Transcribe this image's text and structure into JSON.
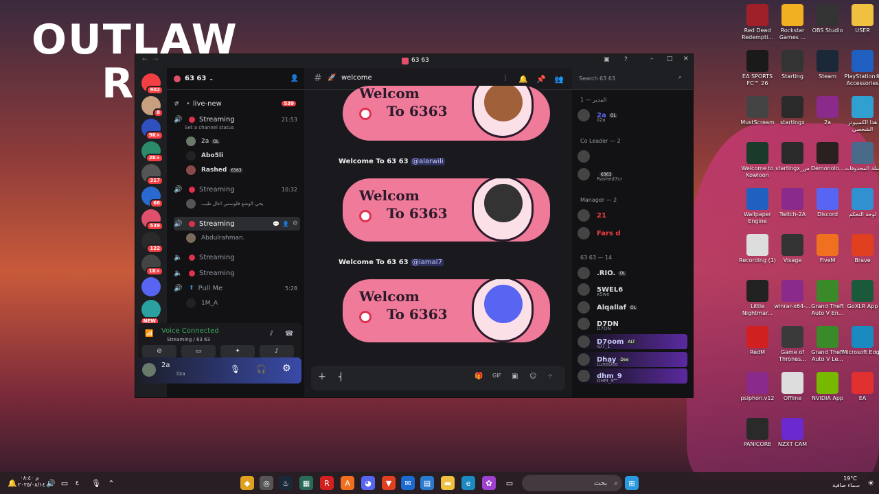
{
  "wallpaper": {
    "logo_line1": "OUTLAW",
    "logo_line2": "R"
  },
  "desktop_icons": [
    {
      "label": "Red Dead Redempti...",
      "icon": "rdr-icon",
      "color": "#a0202a"
    },
    {
      "label": "Rockstar Games ...",
      "icon": "rockstar-icon",
      "color": "#f0b020"
    },
    {
      "label": "OBS Studio",
      "icon": "obs-icon",
      "color": "#333333"
    },
    {
      "label": "USER",
      "icon": "folder-icon",
      "color": "#f0c040"
    },
    {
      "label": "EA SPORTS FC™ 26",
      "icon": "easports-icon",
      "color": "#1a1a1a"
    },
    {
      "label": "Starting",
      "icon": "starting-icon",
      "color": "#333333"
    },
    {
      "label": "Steam",
      "icon": "steam-icon",
      "color": "#1b2838"
    },
    {
      "label": "PlayStation® Accessories",
      "icon": "playstation-icon",
      "color": "#1f5fc0"
    },
    {
      "label": "MustScream",
      "icon": "mustscream-icon",
      "color": "#444444"
    },
    {
      "label": "startingx",
      "icon": "startingx-icon",
      "color": "#2a2a2a"
    },
    {
      "label": "2a",
      "icon": "winrar-icon",
      "color": "#8a2a8a"
    },
    {
      "label": "هذا الكمبيوتر الشخصي",
      "icon": "pc-icon",
      "color": "#30a0d0"
    },
    {
      "label": "Welcome to Kowloon",
      "icon": "kowloon-icon",
      "color": "#1a3a2a"
    },
    {
      "label": "startingx_س",
      "icon": "startingx2-icon",
      "color": "#2a2a2a"
    },
    {
      "label": "Demonolo...",
      "icon": "demonologist-icon",
      "color": "#2a2020"
    },
    {
      "label": "سلة المحذوفات",
      "icon": "recycle-bin-icon",
      "color": "#4a6a8a"
    },
    {
      "label": "Wallpaper Engine",
      "icon": "wallpaper-engine-icon",
      "color": "#2060c0"
    },
    {
      "label": "Twitch-2A",
      "icon": "winrar-icon",
      "color": "#8a2a8a"
    },
    {
      "label": "Discord",
      "icon": "discord-icon",
      "color": "#5865f2"
    },
    {
      "label": "لوحة التحكم",
      "icon": "control-panel-icon",
      "color": "#3090d0"
    },
    {
      "label": "Recording (1)",
      "icon": "recording-icon",
      "color": "#dddddd"
    },
    {
      "label": "Visage",
      "icon": "visage-icon",
      "color": "#333333"
    },
    {
      "label": "FiveM",
      "icon": "fivem-icon",
      "color": "#f07020"
    },
    {
      "label": "Brave",
      "icon": "brave-icon",
      "color": "#e04020"
    },
    {
      "label": "Little Nightmar...",
      "icon": "little-nightmares-icon",
      "color": "#222222"
    },
    {
      "label": "winrar-x64-...",
      "icon": "winrar-icon",
      "color": "#8a2a8a"
    },
    {
      "label": "Grand Theft Auto V En...",
      "icon": "gta-icon",
      "color": "#3a8a2a"
    },
    {
      "label": "GoXLR App",
      "icon": "goxlr-icon",
      "color": "#1a5a3a"
    },
    {
      "label": "RedM",
      "icon": "redm-icon",
      "color": "#d02020"
    },
    {
      "label": "Game of Thrones...",
      "icon": "got-icon",
      "color": "#3a3a3a"
    },
    {
      "label": "Grand Theft Auto V Le...",
      "icon": "gta-icon",
      "color": "#3a8a2a"
    },
    {
      "label": "Microsoft Edge",
      "icon": "edge-icon",
      "color": "#1a8ac0"
    },
    {
      "label": "psiphon.v12",
      "icon": "winrar-icon",
      "color": "#8a2a8a"
    },
    {
      "label": "Offline",
      "icon": "offline-icon",
      "color": "#dddddd"
    },
    {
      "label": "NVIDIA App",
      "icon": "nvidia-icon",
      "color": "#76b900"
    },
    {
      "label": "EA",
      "icon": "ea-icon",
      "color": "#e03030"
    },
    {
      "label": "PANICORE",
      "icon": "panicore-icon",
      "color": "#2a2a2a"
    },
    {
      "label": "NZXT CAM",
      "icon": "nzxt-icon",
      "color": "#6a2ad0"
    }
  ],
  "window": {
    "title": "63 63"
  },
  "servers": [
    {
      "badge": "902",
      "color": "#f23f43"
    },
    {
      "badge": "8",
      "color": "#c8a080"
    },
    {
      "badge": "9K+",
      "color": "#3050c0"
    },
    {
      "badge": "2K+",
      "color": "#2a8a6a"
    },
    {
      "badge": "317",
      "color": "#555555"
    },
    {
      "badge": "66",
      "color": "#2a6ad0"
    },
    {
      "badge": "539",
      "color": "#e0506a"
    },
    {
      "badge": "122",
      "color": "#2a2a2a"
    },
    {
      "badge": "1K+",
      "color": "#444444"
    },
    {
      "badge": "",
      "color": "#5865f2"
    },
    {
      "badge": "NEW",
      "color": "#2aa0a0"
    }
  ],
  "sidebar": {
    "server_name": "63 63",
    "channels": [
      {
        "icon": "#",
        "label": "live-new",
        "badge": "539"
      },
      {
        "icon": "speaker",
        "label": "Streaming",
        "time": "21:53",
        "status": "Set a channel status"
      },
      {
        "icon": "speaker",
        "label": "Streaming",
        "time": "10:32"
      },
      {
        "icon": "speaker",
        "label": "Streaming"
      },
      {
        "icon": "speaker",
        "label": "Streaming"
      },
      {
        "icon": "speaker",
        "label": "Streaming"
      },
      {
        "icon": "speaker",
        "label": "Pull Me",
        "time": "5:28"
      }
    ],
    "users_ch1": [
      {
        "name": "2a",
        "tag": "OL"
      },
      {
        "name": "Abo5li"
      },
      {
        "name": "Rashed",
        "tag": "6363"
      }
    ],
    "user_ch2": "يحي الوضع فلوسس اعال طيب",
    "user_ch3": "Abdulrahman.",
    "user_pullme": "1M_A"
  },
  "voice": {
    "status": "Voice Connected",
    "sub": "Streaming / 63 63"
  },
  "userpanel": {
    "name": "2a",
    "sub": "li2a"
  },
  "header": {
    "channel": "welcome",
    "search_placeholder": "Search 63 63"
  },
  "messages": [
    {
      "text": "Welcome To 63 63",
      "mention": "@alarwili"
    },
    {
      "text": "Welcome To 63 63",
      "mention": "@iamal7"
    }
  ],
  "banner": {
    "line1": "Welcom",
    "line2": "To 6363"
  },
  "members": {
    "groups": [
      {
        "title": "المدير — 1"
      },
      {
        "title": "Co Leader — 2"
      },
      {
        "title": "Manager — 2"
      },
      {
        "title": "63 63 — 14"
      }
    ],
    "list": [
      {
        "name": "2a",
        "sub": "li2a",
        "tag": "OL"
      },
      {
        "name": "",
        "sub": ""
      },
      {
        "name": "",
        "sub": "Rashed7cr",
        "tag": "6363"
      },
      {
        "name": "21",
        "sub": ""
      },
      {
        "name": "Fars d",
        "sub": ""
      },
      {
        "name": ".RIO.",
        "tag": "OL"
      },
      {
        "name": "5WEL6",
        "sub": "x5we"
      },
      {
        "name": "Alqallaf",
        "tag": "OL"
      },
      {
        "name": "D7DN",
        "sub": "D7DN"
      },
      {
        "name": "D7oom",
        "sub": "iD7_1",
        "tag": "ALT"
      },
      {
        "name": "Dhay",
        "sub": "LuneDee",
        "tag": "Dee"
      },
      {
        "name": "dhm_9",
        "sub": "DHM_9"
      }
    ]
  },
  "taskbar": {
    "time": "م ٠٨:٤٠",
    "date": "٢٠٢٥/٠٨/١٤",
    "search": "بحث",
    "weather_temp": "19°C",
    "weather_text": "سماء صافية",
    "lang": "ع"
  }
}
